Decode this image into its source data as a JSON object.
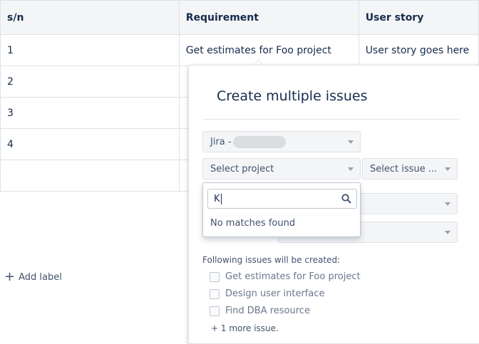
{
  "table": {
    "headers": [
      "s/n",
      "Requirement",
      "User story"
    ],
    "rows": [
      [
        "1",
        "Get estimates for Foo project",
        "User story goes here"
      ],
      [
        "2",
        "",
        ""
      ],
      [
        "3",
        "",
        ""
      ],
      [
        "4",
        "",
        ""
      ],
      [
        "",
        "",
        ""
      ]
    ]
  },
  "add_label": "Add label",
  "popup": {
    "title": "Create multiple issues",
    "jira_select": "Jira -",
    "project_select": "Select project",
    "issue_type_select": "Select issue ...",
    "search_value": "K",
    "no_matches": "No matches found",
    "following_label": "Following issues will be created:",
    "issues": [
      "Get estimates for Foo project",
      "Design user interface",
      "Find DBA resource"
    ],
    "more_issues": "+ 1 more issue."
  }
}
